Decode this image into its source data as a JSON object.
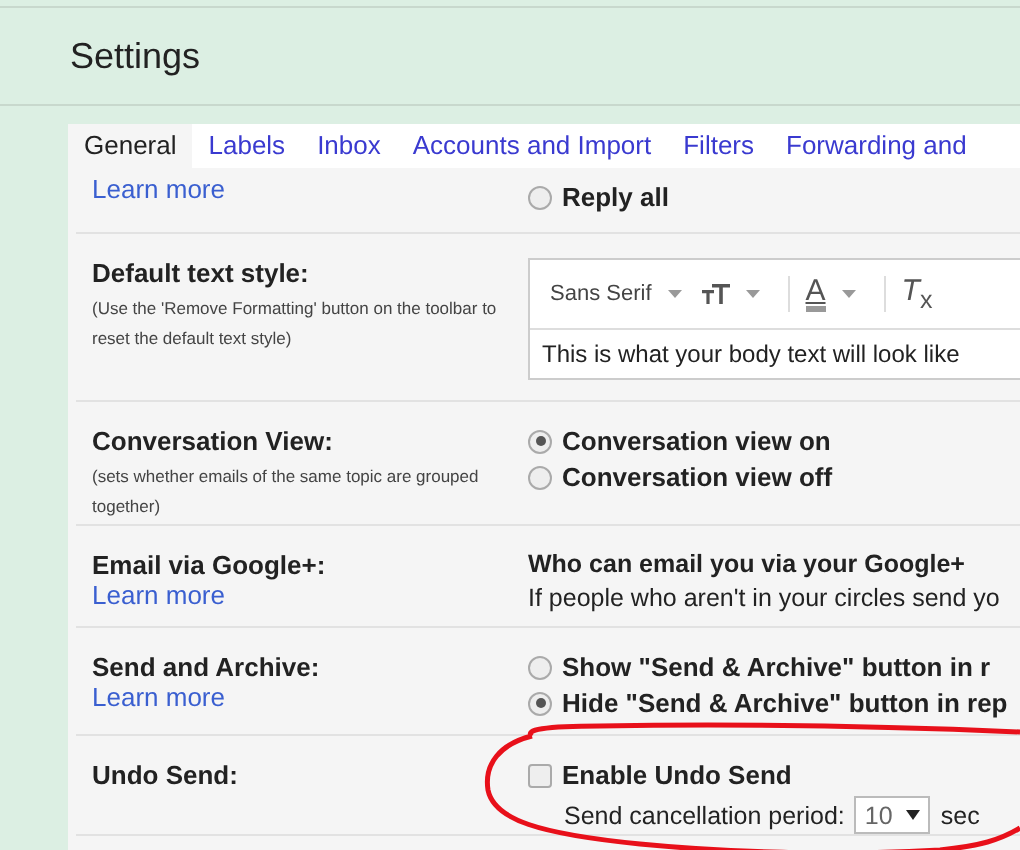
{
  "header": {
    "title": "Settings"
  },
  "tabs": [
    {
      "label": "General",
      "selected": true
    },
    {
      "label": "Labels",
      "selected": false
    },
    {
      "label": "Inbox",
      "selected": false
    },
    {
      "label": "Accounts and Import",
      "selected": false
    },
    {
      "label": "Filters",
      "selected": false
    },
    {
      "label": "Forwarding and",
      "selected": false
    }
  ],
  "rows": [
    {
      "kind": "radios",
      "link": "Learn more",
      "options": [
        {
          "label": "Reply all",
          "selected": false
        }
      ]
    },
    {
      "kind": "text_style",
      "label": "Default text style:",
      "note": "(Use the 'Remove Formatting' button on the toolbar to reset the default text style)",
      "editor": {
        "font": "Sans Serif",
        "color_glyph": "A",
        "clear_glyph": "*T*$_{x}$",
        "sample": "This is what your body text will look like"
      }
    },
    {
      "kind": "radios",
      "label": "Conversation View:",
      "note": "(sets whether emails of the same topic are grouped together)",
      "options": [
        {
          "label": "Conversation view on",
          "selected": true
        },
        {
          "label": "Conversation view off",
          "selected": false
        }
      ]
    },
    {
      "kind": "info",
      "label": "Email via Google+:",
      "link": "Learn more",
      "heading": "Who can email you via your Google+",
      "text": "If people who aren't in your circles send yo"
    },
    {
      "kind": "radios",
      "label": "Send and Archive:",
      "link": "Learn more",
      "options": [
        {
          "label": "Show \"Send & Archive\" button in r",
          "selected": false
        },
        {
          "label": "Hide \"Send & Archive\" button in rep",
          "selected": true
        }
      ]
    },
    {
      "kind": "checkbox",
      "label": "Undo Send:",
      "checkbox": {
        "label": "Enable Undo Send",
        "checked": false
      },
      "period_label": "Send cancellation period:",
      "period_value": "10",
      "period_unit": "sec"
    }
  ]
}
